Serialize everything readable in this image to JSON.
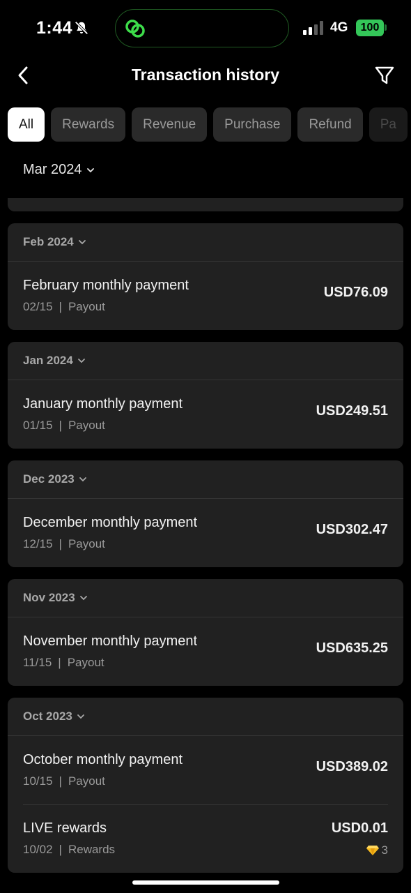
{
  "status_bar": {
    "time": "1:44",
    "network": "4G",
    "battery": "100",
    "icons": [
      "bell-off-icon",
      "link-icon",
      "signal-icon"
    ],
    "colors": {
      "battery": "#34c759",
      "island_border": "#1f5a22",
      "link": "#3ddc4a"
    }
  },
  "header": {
    "title": "Transaction history",
    "icons": [
      "chevron-left-icon",
      "filter-icon"
    ]
  },
  "tabs": [
    {
      "label": "All",
      "active": true
    },
    {
      "label": "Rewards",
      "active": false
    },
    {
      "label": "Revenue",
      "active": false
    },
    {
      "label": "Purchase",
      "active": false
    },
    {
      "label": "Refund",
      "active": false
    },
    {
      "label": "Pa",
      "active": false
    }
  ],
  "month_selector": {
    "label": "Mar 2024"
  },
  "groups": [
    {
      "month": "Feb 2024",
      "transactions": [
        {
          "title": "February monthly payment",
          "date": "02/15",
          "type": "Payout",
          "amount": "USD76.09"
        }
      ]
    },
    {
      "month": "Jan 2024",
      "transactions": [
        {
          "title": "January monthly payment",
          "date": "01/15",
          "type": "Payout",
          "amount": "USD249.51"
        }
      ]
    },
    {
      "month": "Dec 2023",
      "transactions": [
        {
          "title": "December monthly payment",
          "date": "12/15",
          "type": "Payout",
          "amount": "USD302.47"
        }
      ]
    },
    {
      "month": "Nov 2023",
      "transactions": [
        {
          "title": "November monthly payment",
          "date": "11/15",
          "type": "Payout",
          "amount": "USD635.25"
        }
      ]
    },
    {
      "month": "Oct 2023",
      "transactions": [
        {
          "title": "October monthly payment",
          "date": "10/15",
          "type": "Payout",
          "amount": "USD389.02"
        },
        {
          "title": "LIVE rewards",
          "date": "10/02",
          "type": "Rewards",
          "amount": "USD0.01",
          "gems": "3",
          "gem_icon": "diamond-icon"
        }
      ]
    }
  ],
  "separator": "|"
}
